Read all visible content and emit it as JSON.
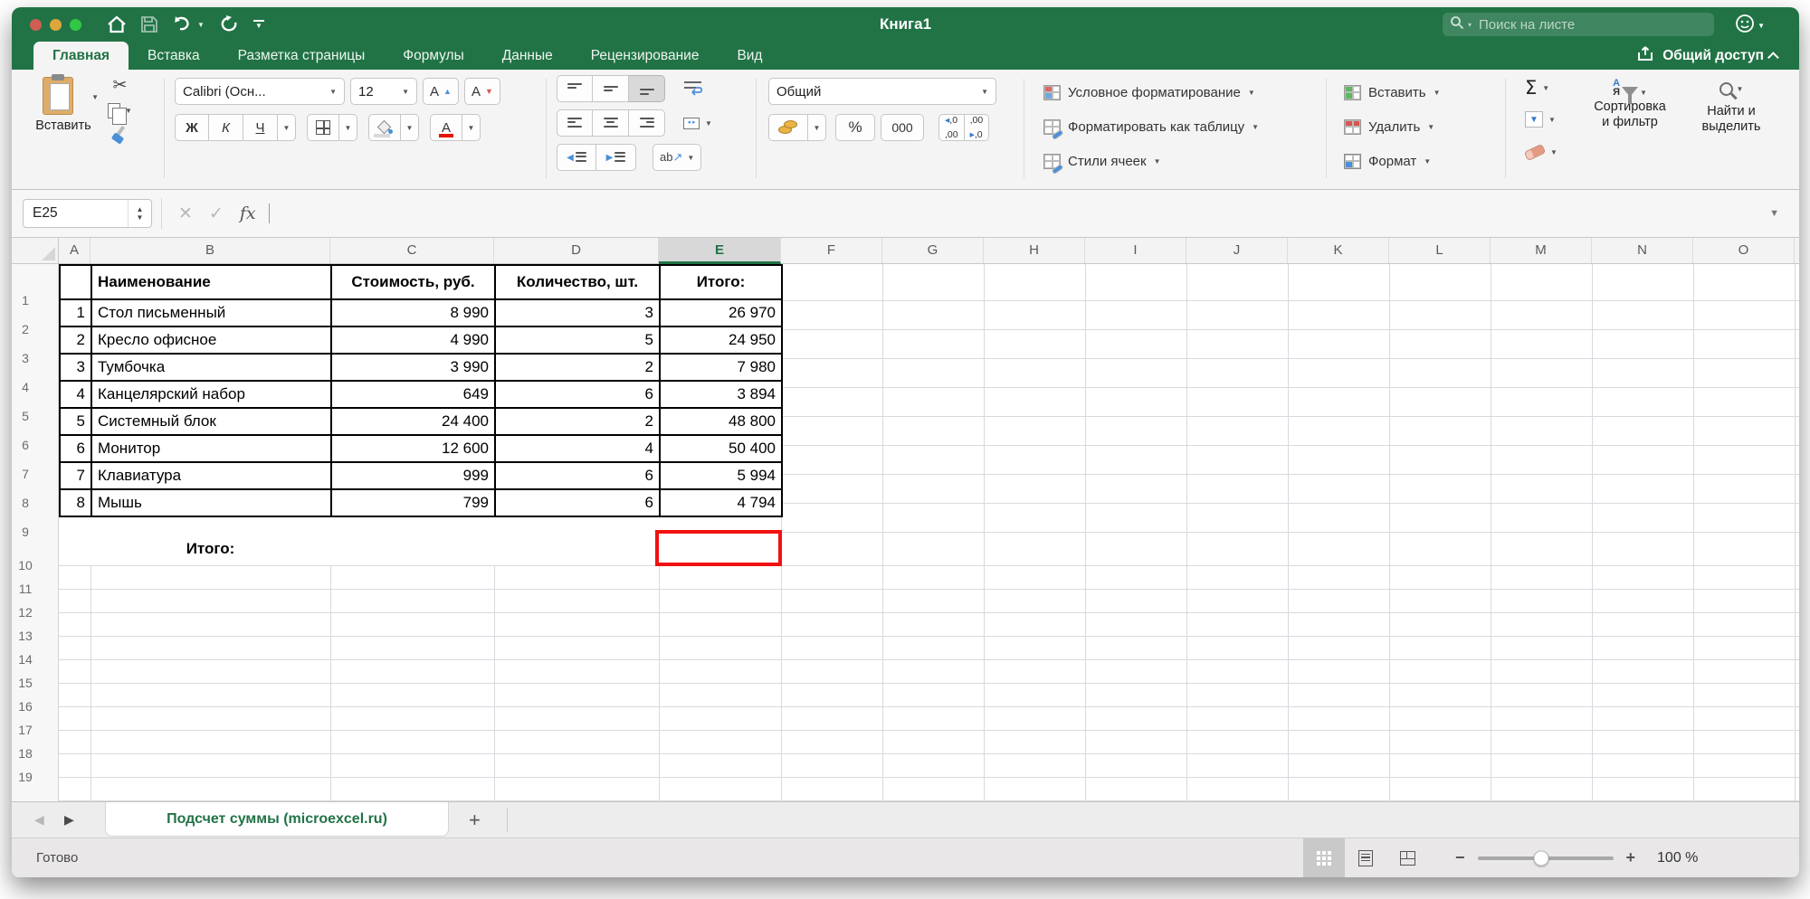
{
  "titlebar": {
    "title": "Книга1",
    "search_placeholder": "Поиск на листе",
    "share_label": "Общий доступ"
  },
  "ribbon_tabs": {
    "home": "Главная",
    "insert": "Вставка",
    "layout": "Разметка страницы",
    "formulas": "Формулы",
    "data": "Данные",
    "review": "Рецензирование",
    "view": "Вид"
  },
  "ribbon": {
    "paste_label": "Вставить",
    "font": {
      "name": "Calibri (Осн...",
      "size": "12",
      "grow": "A",
      "shrink": "A",
      "bold": "Ж",
      "italic": "К",
      "underline": "Ч",
      "color_letter": "А"
    },
    "alignment": {
      "orientation_ab": "ab",
      "orientation_arrow": "↗"
    },
    "number": {
      "format": "Общий",
      "percent": "%",
      "thousands": "000",
      "dec1_top": ",0",
      "dec1_bottom": ",00",
      "dec2_top": ",00",
      "dec2_bottom": ",0"
    },
    "styles": {
      "conditional": "Условное форматирование",
      "format_table": "Форматировать как таблицу",
      "cell_styles": "Стили ячеек"
    },
    "cells": {
      "insert": "Вставить",
      "delete": "Удалить",
      "format": "Формат"
    },
    "editing": {
      "autosum": "Σ",
      "sort_line1": "Сортировка",
      "sort_line2": "и фильтр",
      "find_line1": "Найти и",
      "find_line2": "выделить"
    }
  },
  "formula_bar": {
    "name_box": "E25",
    "fx": "fx"
  },
  "grid": {
    "columns": [
      "A",
      "B",
      "C",
      "D",
      "E",
      "F",
      "G",
      "H",
      "I",
      "J",
      "K",
      "L",
      "M",
      "N",
      "O"
    ],
    "selected_column": "E",
    "rows": [
      "1",
      "2",
      "3",
      "4",
      "5",
      "6",
      "7",
      "8",
      "9",
      "10",
      "11",
      "12",
      "13",
      "14",
      "15",
      "16",
      "17",
      "18",
      "19"
    ]
  },
  "table": {
    "headers": {
      "name": "Наименование",
      "price": "Стоимость, руб.",
      "qty": "Количество, шт.",
      "total": "Итого:"
    },
    "rows": [
      {
        "n": "1",
        "name": "Стол письменный",
        "price": "8 990",
        "qty": "3",
        "total": "26 970"
      },
      {
        "n": "2",
        "name": "Кресло офисное",
        "price": "4 990",
        "qty": "5",
        "total": "24 950"
      },
      {
        "n": "3",
        "name": "Тумбочка",
        "price": "3 990",
        "qty": "2",
        "total": "7 980"
      },
      {
        "n": "4",
        "name": "Канцелярский набор",
        "price": "649",
        "qty": "6",
        "total": "3 894"
      },
      {
        "n": "5",
        "name": "Системный блок",
        "price": "24 400",
        "qty": "2",
        "total": "48 800"
      },
      {
        "n": "6",
        "name": "Монитор",
        "price": "12 600",
        "qty": "4",
        "total": "50 400"
      },
      {
        "n": "7",
        "name": "Клавиатура",
        "price": "999",
        "qty": "6",
        "total": "5 994"
      },
      {
        "n": "8",
        "name": "Мышь",
        "price": "799",
        "qty": "6",
        "total": "4 794"
      }
    ],
    "footer_label": "Итого:"
  },
  "sheet_tabs": {
    "active": "Подсчет суммы (microexcel.ru)",
    "add": "+"
  },
  "status_bar": {
    "ready": "Готово",
    "zoom": "100 %"
  },
  "colors": {
    "excel_green": "#217346",
    "selection_red": "#f21111",
    "grid_line": "#d6dade",
    "table_border": "#000000"
  }
}
